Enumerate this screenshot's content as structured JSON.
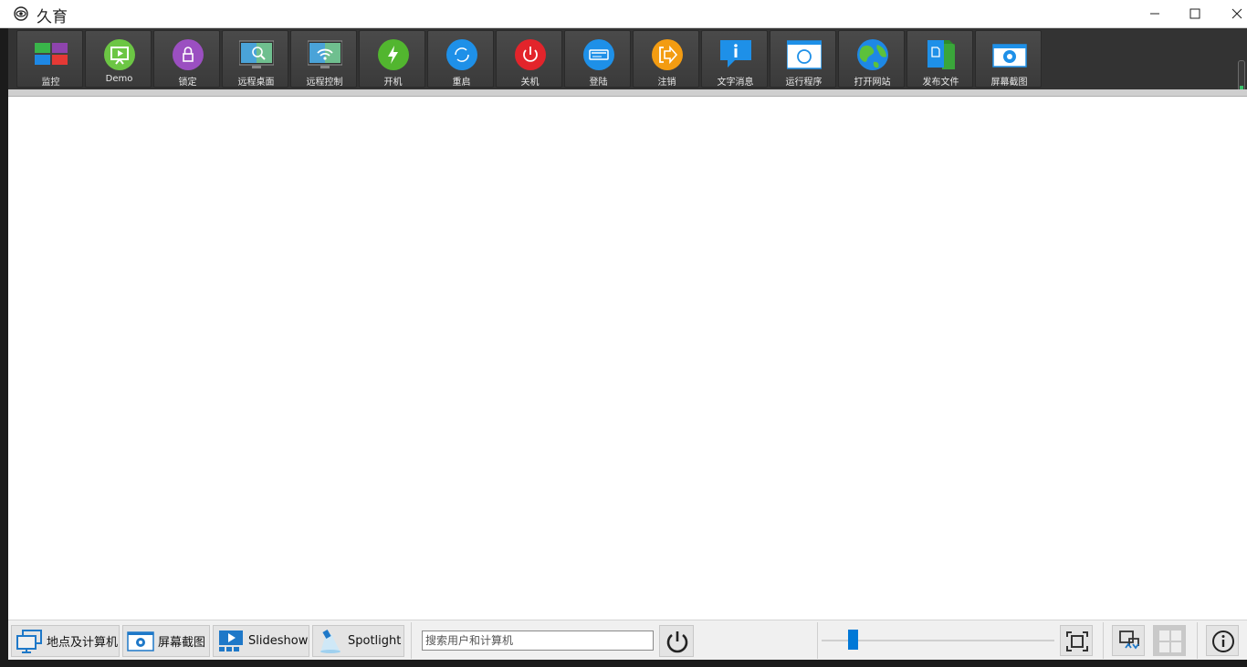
{
  "window": {
    "title": "久育",
    "controls": {
      "minimize": "—",
      "maximize": "☐",
      "close": "✕"
    }
  },
  "toolbar": {
    "buttons": [
      {
        "label": "监控",
        "icon": "monitor-grid-icon"
      },
      {
        "label": "Demo",
        "icon": "presentation-icon"
      },
      {
        "label": "锁定",
        "icon": "lock-icon"
      },
      {
        "label": "远程桌面",
        "icon": "remote-desktop-icon"
      },
      {
        "label": "远程控制",
        "icon": "remote-control-icon"
      },
      {
        "label": "开机",
        "icon": "power-on-icon"
      },
      {
        "label": "重启",
        "icon": "restart-icon"
      },
      {
        "label": "关机",
        "icon": "shutdown-icon"
      },
      {
        "label": "登陆",
        "icon": "login-icon"
      },
      {
        "label": "注销",
        "icon": "logout-icon"
      },
      {
        "label": "文字消息",
        "icon": "message-icon"
      },
      {
        "label": "运行程序",
        "icon": "run-program-icon"
      },
      {
        "label": "打开网站",
        "icon": "globe-icon"
      },
      {
        "label": "发布文件",
        "icon": "publish-file-icon"
      },
      {
        "label": "屏幕截图",
        "icon": "screenshot-icon"
      }
    ]
  },
  "statusbar": {
    "locations_label": "地点及计算机",
    "screenshot_label": "屏幕截图",
    "slideshow_label": "Slideshow",
    "spotlight_label": "Spotlight",
    "search_placeholder": "搜索用户和计算机",
    "zoom_value": 0.12
  },
  "colors": {
    "toolbar_bg": "#333333",
    "accent": "#0078d7",
    "green": "#39c26a"
  }
}
